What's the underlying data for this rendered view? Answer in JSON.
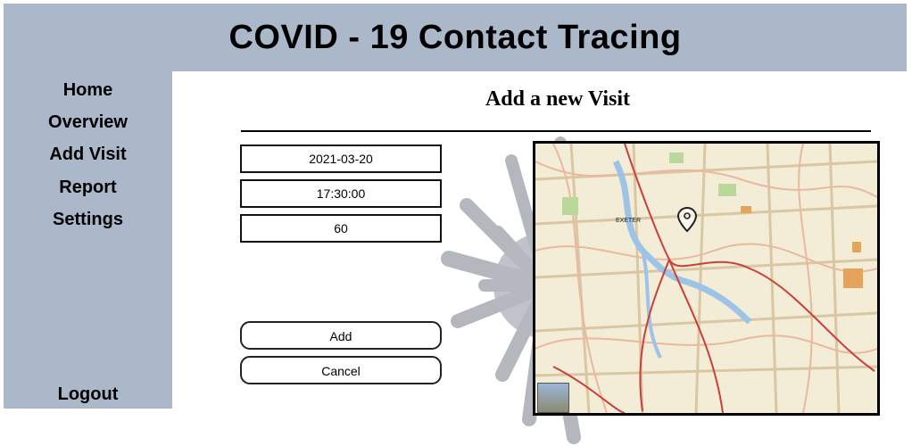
{
  "header": {
    "title": "COVID - 19 Contact Tracing"
  },
  "sidebar": {
    "items": [
      {
        "label": "Home"
      },
      {
        "label": "Overview"
      },
      {
        "label": "Add Visit"
      },
      {
        "label": "Report"
      },
      {
        "label": "Settings"
      }
    ],
    "logout_label": "Logout"
  },
  "main": {
    "title": "Add a new Visit",
    "form": {
      "date_value": "2021-03-20",
      "time_value": "17:30:00",
      "duration_value": "60"
    },
    "buttons": {
      "add_label": "Add",
      "cancel_label": "Cancel"
    },
    "map": {
      "place_label": "EXETER",
      "marker_icon": "map-pin-icon"
    }
  }
}
